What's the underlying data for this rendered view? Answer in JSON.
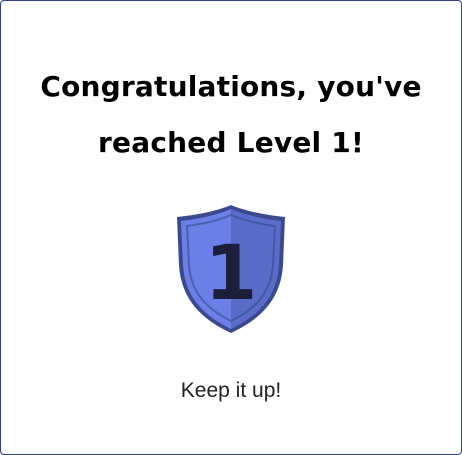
{
  "dialog": {
    "title_line1": "Congratulations, you've",
    "title_line2": "reached Level 1!",
    "badge_level": "1",
    "message": "Keep it up!"
  },
  "badge": {
    "icon": "shield-level-icon",
    "colors": {
      "light": "#6b7fe6",
      "dark": "#5b6cc8",
      "outline": "#3b4a8f",
      "numeral": "#1b1f3a"
    }
  }
}
